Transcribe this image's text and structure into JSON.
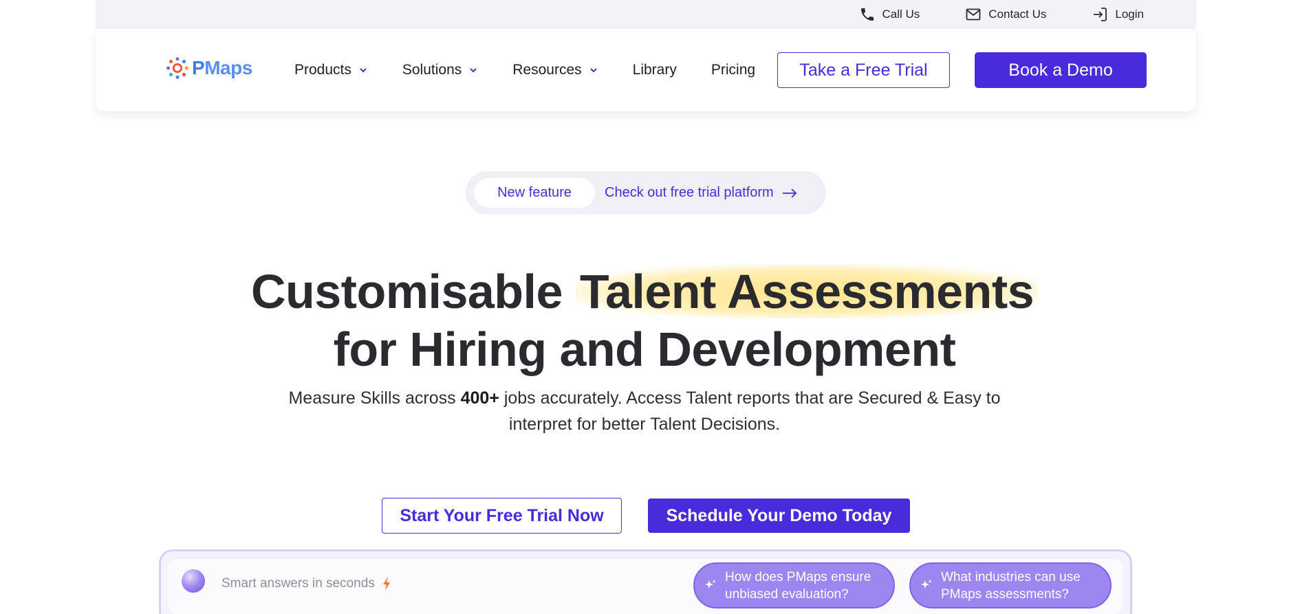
{
  "utility": {
    "call": "Call Us",
    "contact": "Contact Us",
    "login": "Login"
  },
  "brand": {
    "name_p": "P",
    "name_rest": "Maps"
  },
  "nav": {
    "products": "Products",
    "solutions": "Solutions",
    "resources": "Resources",
    "library": "Library",
    "pricing": "Pricing",
    "free_trial": "Take a Free Trial",
    "book_demo": "Book a Demo"
  },
  "feature": {
    "tag": "New feature",
    "text": "Check out free trial platform"
  },
  "hero": {
    "title_part1": "Customisable ",
    "title_highlight": "Talent Assessments",
    "title_line2": "for Hiring and Development",
    "sub_part1": "Measure Skills across ",
    "sub_bold": "400+",
    "sub_part2": " jobs accurately. Access Talent reports that are Secured & Easy to interpret for better Talent Decisions."
  },
  "cta": {
    "trial": "Start Your Free Trial Now",
    "demo": "Schedule Your Demo Today"
  },
  "assistant": {
    "placeholder": "Smart answers in seconds",
    "suggestion_1": "How does PMaps ensure unbiased evaluation?",
    "suggestion_2": "What industries can use PMaps assessments?"
  },
  "colors": {
    "accent": "#4a2bdb",
    "highlight": "#ffe280",
    "suggestion_bg": "#9c87f1"
  }
}
